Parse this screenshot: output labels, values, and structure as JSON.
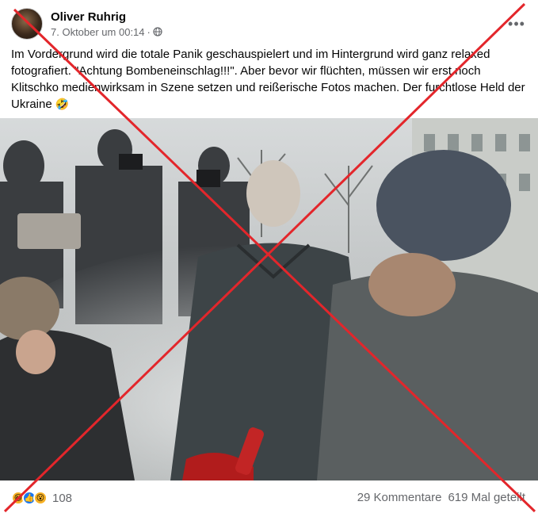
{
  "post": {
    "author": "Oliver Ruhrig",
    "date": "7. Oktober um 00:14",
    "separator": "·",
    "privacy_icon": "globe-icon",
    "more_icon": "more-options-icon",
    "text_part1": "Im Vordergrund wird die totale Panik geschauspielert und im Hintergrund wird ganz relaxed fotografiert. \"Achtung Bombeneinschlag!!!\". Aber bevor wir flüchten, müssen wir erst noch Klitschko medienwirksam in Szene setzen und reißerische Fotos machen. Der furchtlose Held der Ukraine",
    "text_emoji": "🤣"
  },
  "footer": {
    "reactions": [
      "haha",
      "like",
      "wow"
    ],
    "reaction_count": "108",
    "comments": "29 Kommentare",
    "shares": "619 Mal geteilt"
  },
  "overlay": {
    "cross_color": "#e3262b"
  },
  "photo": {
    "description_icon": "news-photo-image"
  }
}
